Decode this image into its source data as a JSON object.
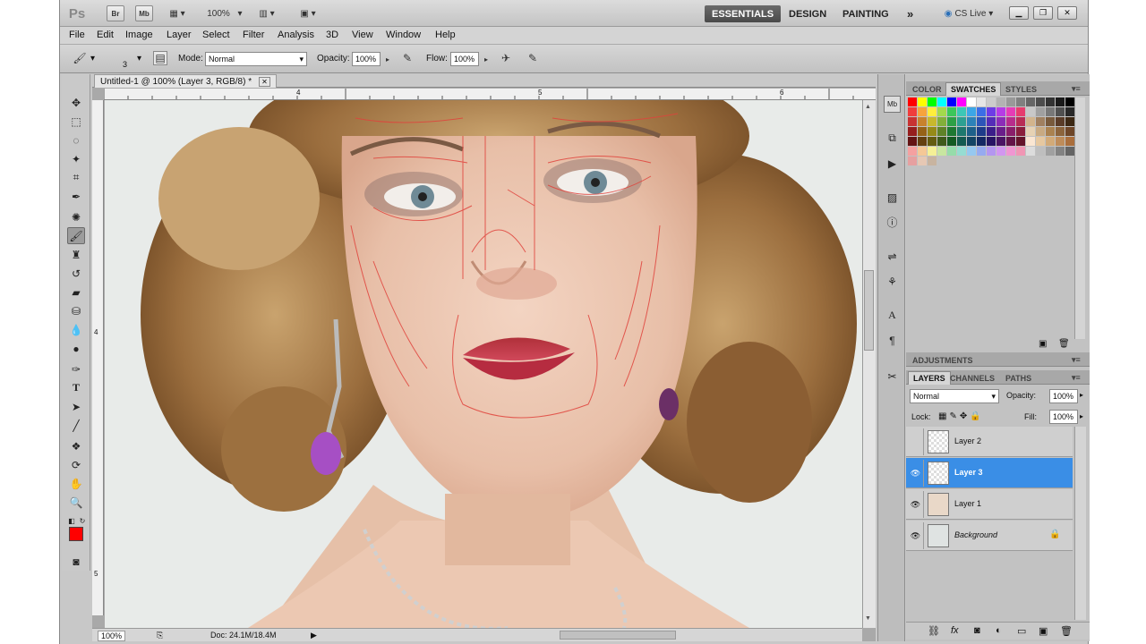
{
  "app": {
    "logo": "Ps",
    "btn_br": "Br",
    "btn_mb": "Mb",
    "zoom": "100%"
  },
  "workspaces": [
    "ESSENTIALS",
    "DESIGN",
    "PAINTING"
  ],
  "cslive": "CS Live",
  "menu": [
    "File",
    "Edit",
    "Image",
    "Layer",
    "Select",
    "Filter",
    "Analysis",
    "3D",
    "View",
    "Window",
    "Help"
  ],
  "options": {
    "brush_size": "3",
    "mode_label": "Mode:",
    "mode_value": "Normal",
    "opacity_label": "Opacity:",
    "opacity_value": "100%",
    "flow_label": "Flow:",
    "flow_value": "100%"
  },
  "document": {
    "tab_title": "Untitled-1 @ 100% (Layer 3, RGB/8) *",
    "ruler_marks": [
      "4",
      "5",
      "6"
    ],
    "left_ruler_marks": [
      "4",
      "5"
    ],
    "zoom": "100%",
    "doc_info": "Doc: 24.1M/18.4M"
  },
  "swatch_panel": {
    "tabs": [
      "COLOR",
      "SWATCHES",
      "STYLES"
    ],
    "active": "SWATCHES"
  },
  "adjustments_label": "ADJUSTMENTS",
  "layers_panel": {
    "tabs": [
      "LAYERS",
      "CHANNELS",
      "PATHS"
    ],
    "blend_mode": "Normal",
    "opacity_label": "Opacity:",
    "opacity_value": "100%",
    "lock_label": "Lock:",
    "fill_label": "Fill:",
    "fill_value": "100%",
    "layers": [
      {
        "name": "Layer 2",
        "visible": false,
        "selected": false
      },
      {
        "name": "Layer 3",
        "visible": true,
        "selected": true
      },
      {
        "name": "Layer 1",
        "visible": true,
        "selected": false
      },
      {
        "name": "Background",
        "visible": true,
        "selected": false,
        "locked": true
      }
    ]
  },
  "colors": {
    "foreground": "#ff0000",
    "background": "#ffffff",
    "accent": "#3a8ee6"
  }
}
